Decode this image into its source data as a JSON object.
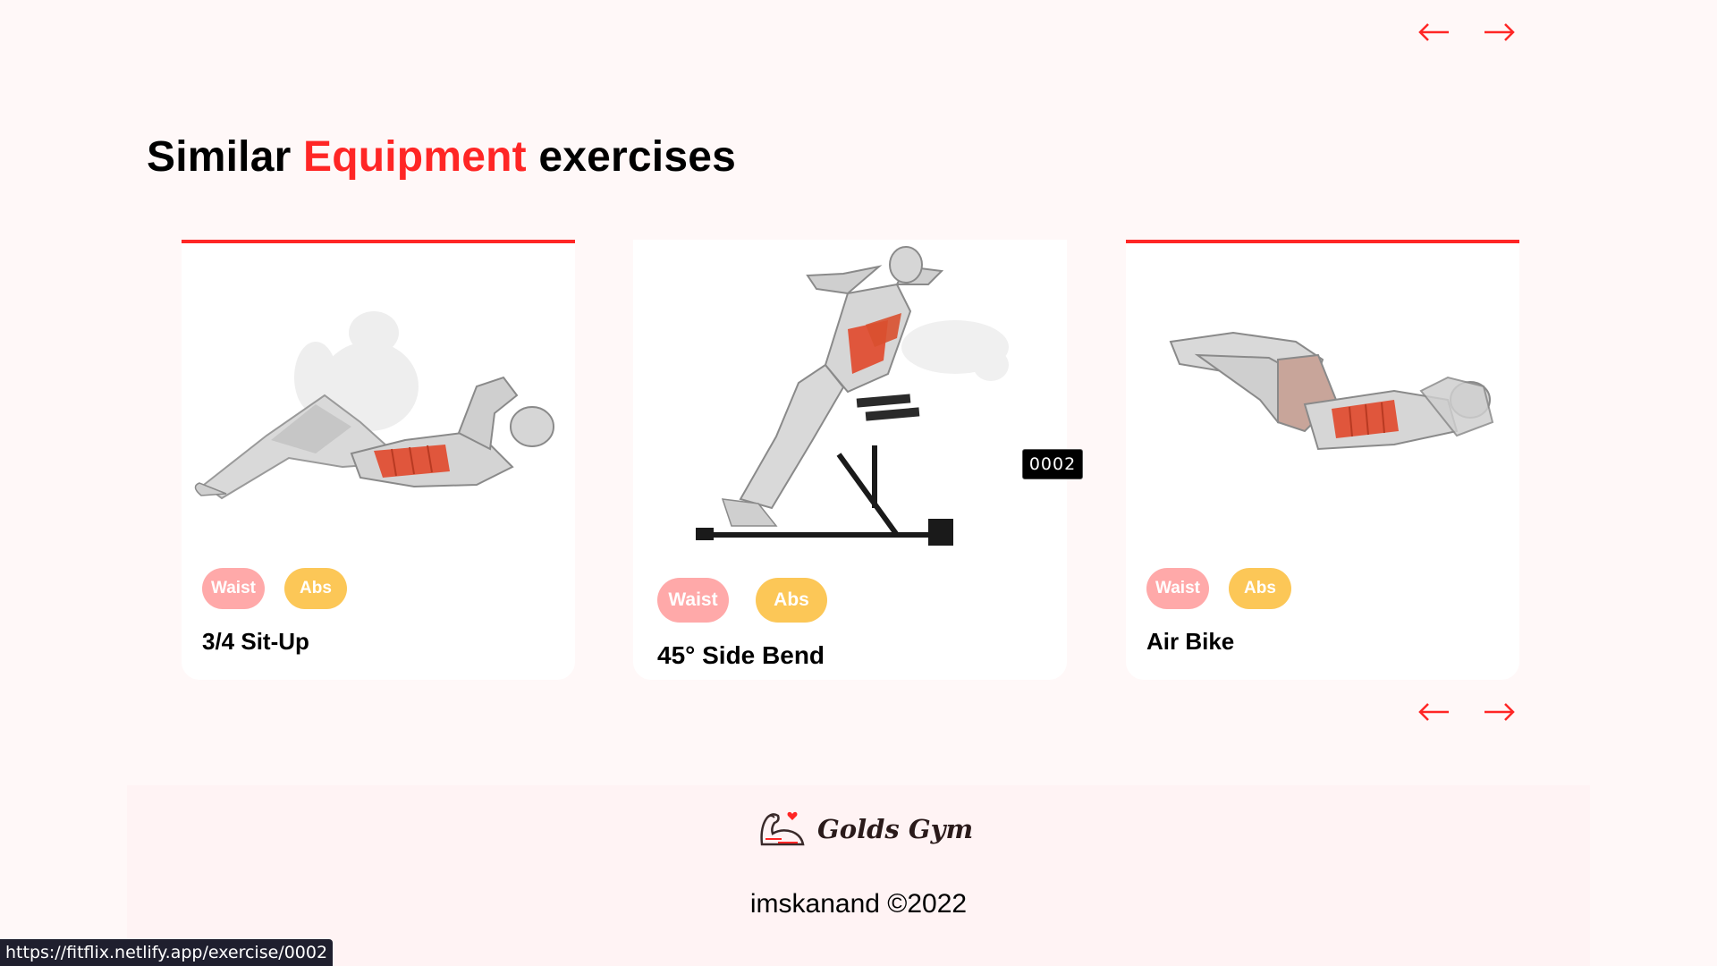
{
  "navigation": {
    "prev_icon": "arrow-left-icon",
    "next_icon": "arrow-right-icon",
    "arrow_color": "#ff2625"
  },
  "section": {
    "title_before": "Similar ",
    "title_accent": "Equipment",
    "title_after": " exercises",
    "accent_color": "#ff2625"
  },
  "cards": [
    {
      "name": "3/4 Sit-Up",
      "tags": [
        "Waist",
        "Abs"
      ],
      "figure": "situp-illustration",
      "highlighted": true
    },
    {
      "name": "45° Side Bend",
      "tags": [
        "Waist",
        "Abs"
      ],
      "figure": "side-bend-illustration",
      "highlighted": false
    },
    {
      "name": "Air Bike",
      "tags": [
        "Waist",
        "Abs"
      ],
      "figure": "air-bike-illustration",
      "highlighted": true
    }
  ],
  "tag_colors": {
    "waist": "#ffa9a9",
    "abs": "#fcc757"
  },
  "tooltip": {
    "text": "0002"
  },
  "footer": {
    "brand": "Golds Gym",
    "logo_icon": "flexed-arm-heart-icon",
    "copyright": "imskanand ©2022"
  },
  "status_bar": {
    "url": "https://fitflix.netlify.app/exercise/0002"
  }
}
